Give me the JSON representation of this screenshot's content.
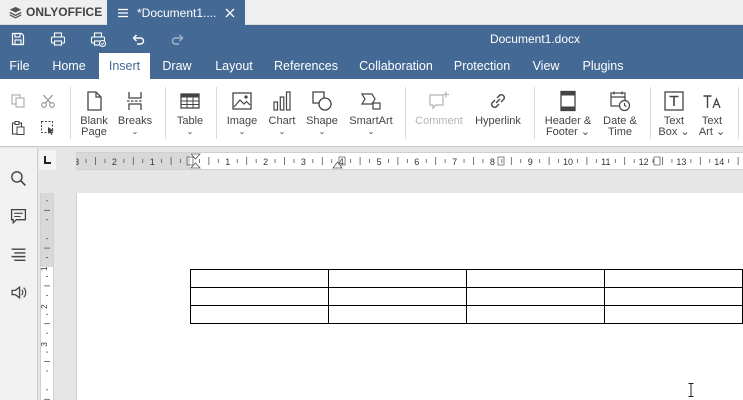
{
  "app": {
    "brand": "ONLYOFFICE",
    "tab_title": "*Document1....",
    "document_name": "Document1.docx"
  },
  "quick_access": [
    {
      "name": "save",
      "icon": "save-icon"
    },
    {
      "name": "print",
      "icon": "print-icon"
    },
    {
      "name": "quick-print",
      "icon": "quick-print-icon"
    },
    {
      "name": "undo",
      "icon": "undo-icon"
    },
    {
      "name": "redo",
      "icon": "redo-icon"
    }
  ],
  "menu": {
    "active": "Insert",
    "items": [
      "File",
      "Home",
      "Insert",
      "Draw",
      "Layout",
      "References",
      "Collaboration",
      "Protection",
      "View",
      "Plugins"
    ]
  },
  "toolbar": {
    "blank_page": "Blank Page",
    "breaks": "Breaks",
    "table": "Table",
    "image": "Image",
    "chart": "Chart",
    "shape": "Shape",
    "smartart": "SmartArt",
    "comment": "Comment",
    "hyperlink": "Hyperlink",
    "header_footer": "Header & Footer",
    "date_time": "Date & Time",
    "text_box": "Text Box",
    "text_art": "Text Art"
  },
  "ruler": {
    "horizontal_labels": [
      "3",
      "2",
      "1",
      "1",
      "2",
      "3",
      "4",
      "5",
      "6",
      "7",
      "8",
      "9",
      "10",
      "11",
      "12",
      "13",
      "14"
    ],
    "vertical_labels": [
      "1",
      "2",
      "3"
    ]
  },
  "document_table": {
    "rows": 3,
    "columns": 4
  },
  "colors": {
    "accent": "#446995",
    "toolbar_bg": "#ffffff",
    "panel_bg": "#f1f1f1"
  }
}
